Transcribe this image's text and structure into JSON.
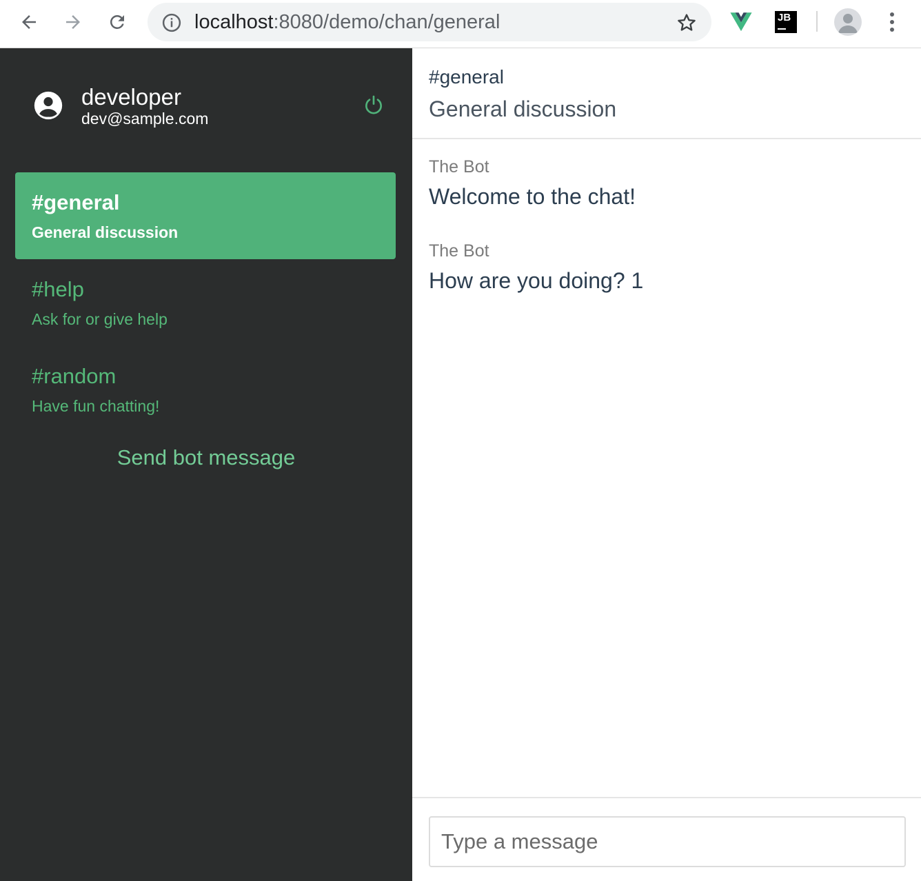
{
  "browser": {
    "url_host": "localhost",
    "url_path": ":8080/demo/chan/general",
    "extensions": [
      "vue-devtools-icon",
      "jetbrains-icon"
    ],
    "jb_label": "JB"
  },
  "sidebar": {
    "user": {
      "name": "developer",
      "email": "dev@sample.com"
    },
    "channels": [
      {
        "name": "#general",
        "description": "General discussion",
        "active": true
      },
      {
        "name": "#help",
        "description": "Ask for or give help",
        "active": false
      },
      {
        "name": "#random",
        "description": "Have fun chatting!",
        "active": false
      }
    ],
    "send_bot_label": "Send bot message"
  },
  "main": {
    "channel_name": "#general",
    "channel_description": "General discussion",
    "messages": [
      {
        "author": "The Bot",
        "text": "Welcome to the chat!"
      },
      {
        "author": "The Bot",
        "text": "How are you doing? 1"
      }
    ],
    "composer_placeholder": "Type a message"
  },
  "colors": {
    "sidebar_bg": "#2b2d2d",
    "accent_green": "#50b27a",
    "channel_text": "#55b979"
  }
}
